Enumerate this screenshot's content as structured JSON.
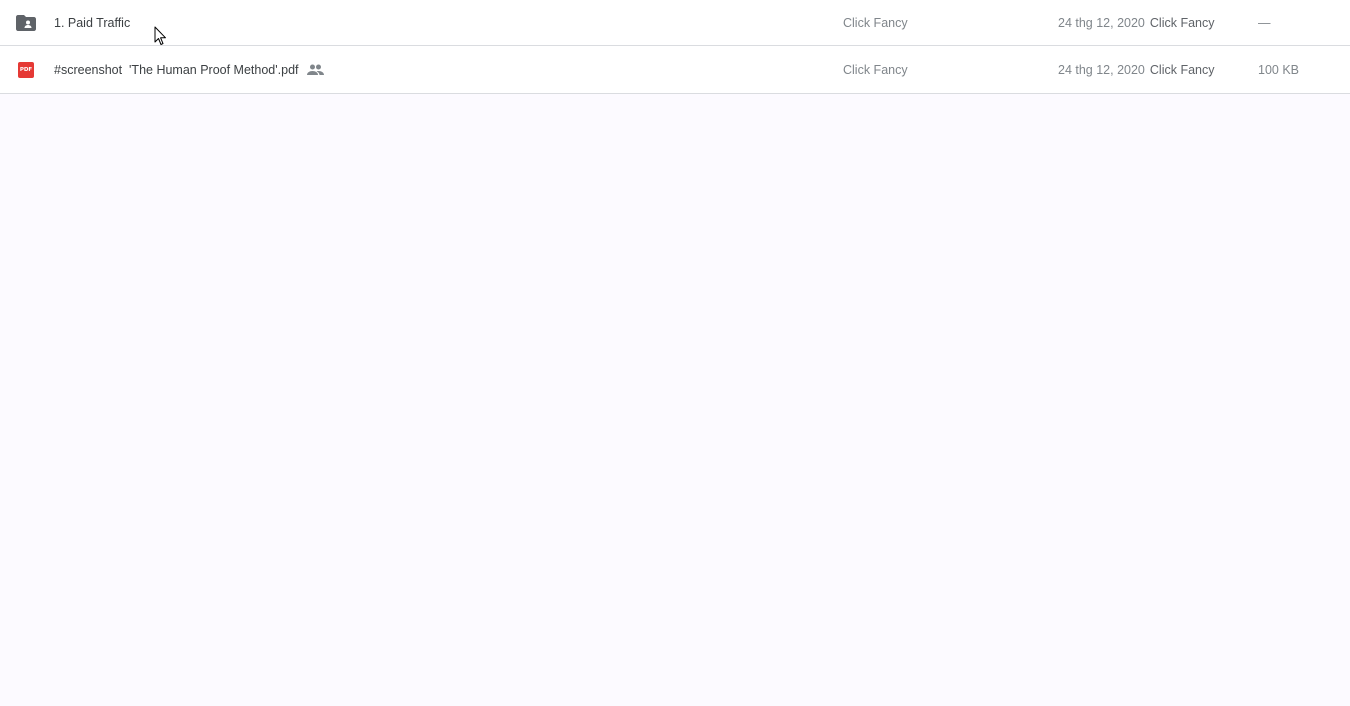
{
  "files": [
    {
      "icon": "shared-folder-icon",
      "name": "1. Paid Traffic",
      "shared": false,
      "owner": "Click Fancy",
      "modified_date": "24 thg 12, 2020",
      "modified_by": "Click Fancy",
      "size": "—"
    },
    {
      "icon": "pdf-icon",
      "icon_label": "PDF",
      "name": "#screenshot  'The Human Proof Method'.pdf",
      "shared": true,
      "shared_icon": "people-icon",
      "owner": "Click Fancy",
      "modified_date": "24 thg 12, 2020",
      "modified_by": "Click Fancy",
      "size": "100 KB"
    }
  ],
  "colors": {
    "background": "#fcfaff",
    "row_background": "#ffffff",
    "divider": "#dadce0",
    "folder_icon": "#5f6368",
    "pdf_icon": "#e53935",
    "primary_text": "#3c4043",
    "secondary_text": "#80868b"
  }
}
